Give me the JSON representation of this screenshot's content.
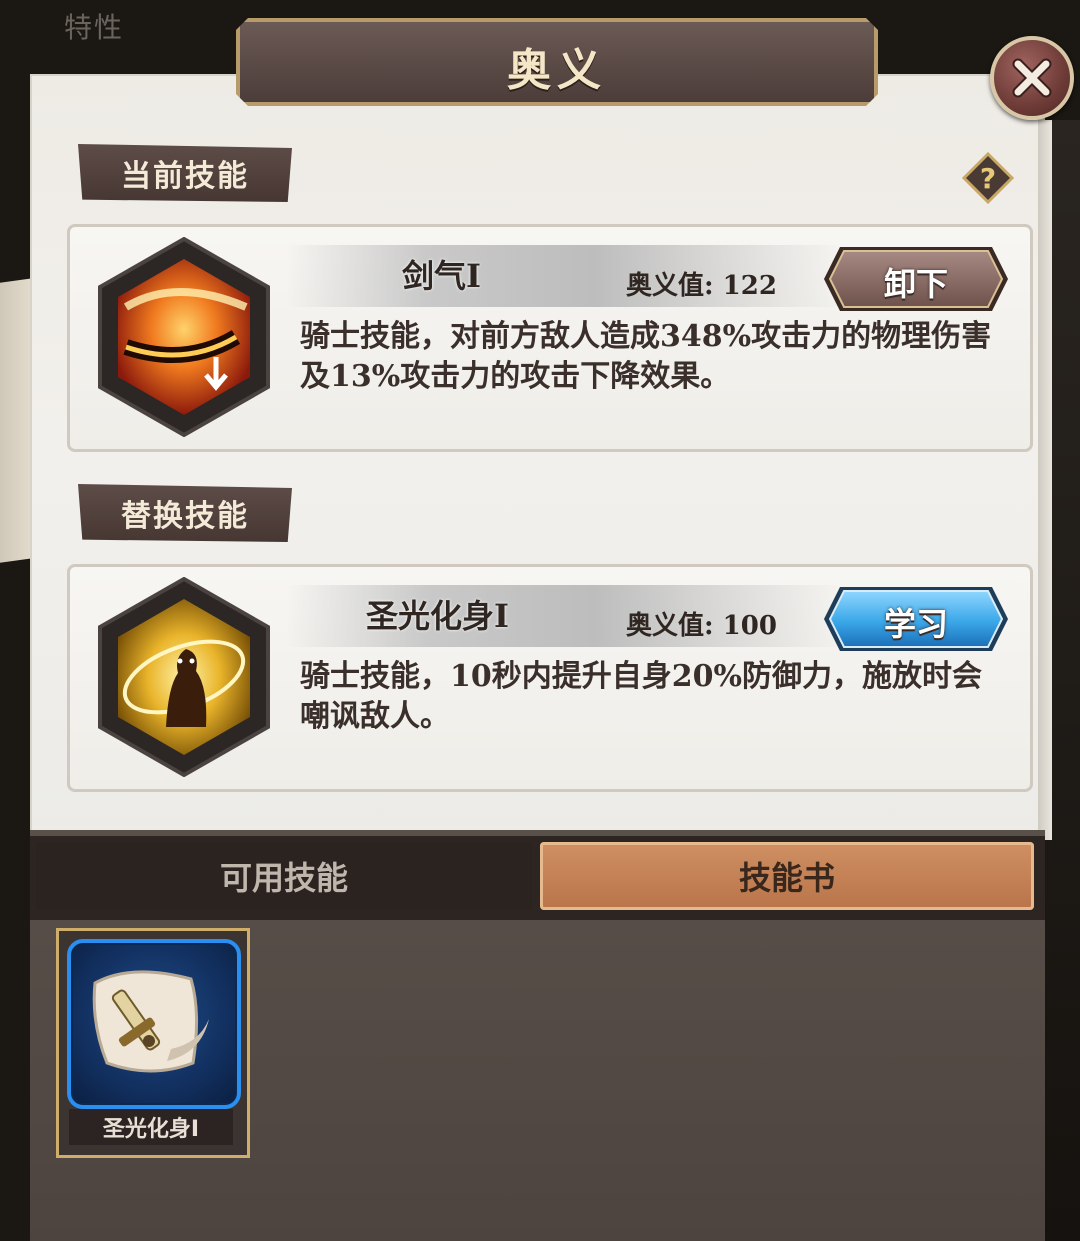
{
  "background": {
    "top_left_text": "特性"
  },
  "title": "奥义",
  "sections": {
    "current_label": "当前技能",
    "replace_label": "替换技能"
  },
  "current_skill": {
    "name": "剑气Ⅰ",
    "ougi_value": "奥义值: 122",
    "description": "骑士技能，对前方敌人造成348%攻击力的物理伤害及13%攻击力的攻击下降效果。",
    "button_label": "卸下",
    "icon": "sword-slash-icon"
  },
  "replacement_skill": {
    "name": "圣光化身Ⅰ",
    "ougi_value": "奥义值: 100",
    "description": "骑士技能，10秒内提升自身20%防御力，施放时会嘲讽敌人。",
    "button_label": "学习",
    "icon": "holy-avatar-icon"
  },
  "tabs": [
    {
      "label": "可用技能",
      "selected": false
    },
    {
      "label": "技能书",
      "selected": true
    }
  ],
  "inventory": [
    {
      "name": "圣光化身Ⅰ",
      "icon": "skill-book-scroll-icon"
    }
  ],
  "colors": {
    "accent_gold": "#cfae6b",
    "tab_selected": "#c17c52",
    "learn_button": "#3aa7e8",
    "unequip_button": "#7a5a55"
  }
}
